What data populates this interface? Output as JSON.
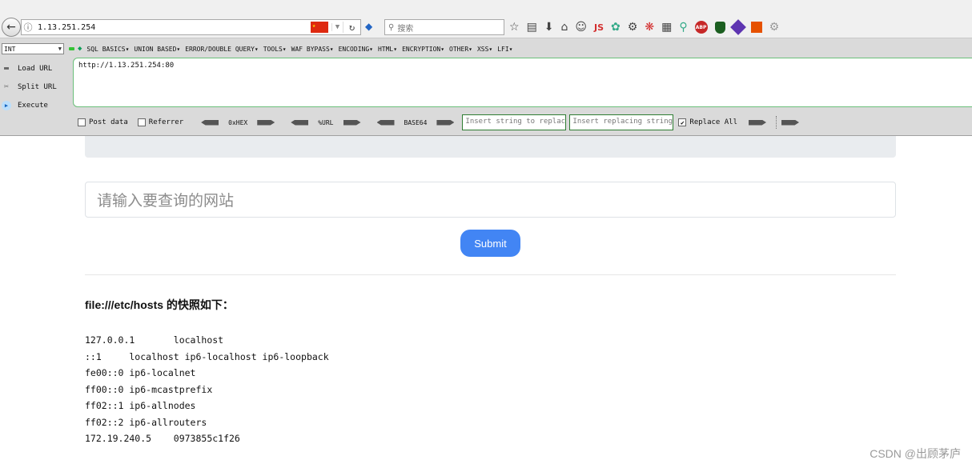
{
  "browser": {
    "url": "1.13.251.254",
    "search_placeholder": "搜索"
  },
  "hackbar": {
    "select_value": "INT",
    "menu": [
      "SQL BASICS▾",
      "UNION BASED▾",
      "ERROR/DOUBLE QUERY▾",
      "TOOLS▾",
      "WAF BYPASS▾",
      "ENCODING▾",
      "HTML▾",
      "ENCRYPTION▾",
      "OTHER▾",
      "XSS▾",
      "LFI▾"
    ],
    "load_url": "Load URL",
    "split_url": "Split URL",
    "execute": "Execute",
    "textarea": "http://1.13.251.254:80",
    "post_data": "Post data",
    "referrer": "Referrer",
    "hex": "0xHEX",
    "url_enc": "%URL",
    "base64": "BASE64",
    "replace_input_placeholder": "Insert string to replace",
    "replacing_input_placeholder": "Insert replacing string",
    "replace_all": "Replace All"
  },
  "page": {
    "site_input_placeholder": "请输入要查询的网站",
    "submit": "Submit",
    "result_title": "file:///etc/hosts 的快照如下：",
    "hosts_lines": [
      "127.0.0.1       localhost",
      "::1     localhost ip6-localhost ip6-loopback",
      "fe00::0 ip6-localnet",
      "ff00::0 ip6-mcastprefix",
      "ff02::1 ip6-allnodes",
      "ff02::2 ip6-allrouters",
      "172.19.240.5    0973855c1f26"
    ],
    "watermark": "CSDN @出顾茅庐"
  }
}
